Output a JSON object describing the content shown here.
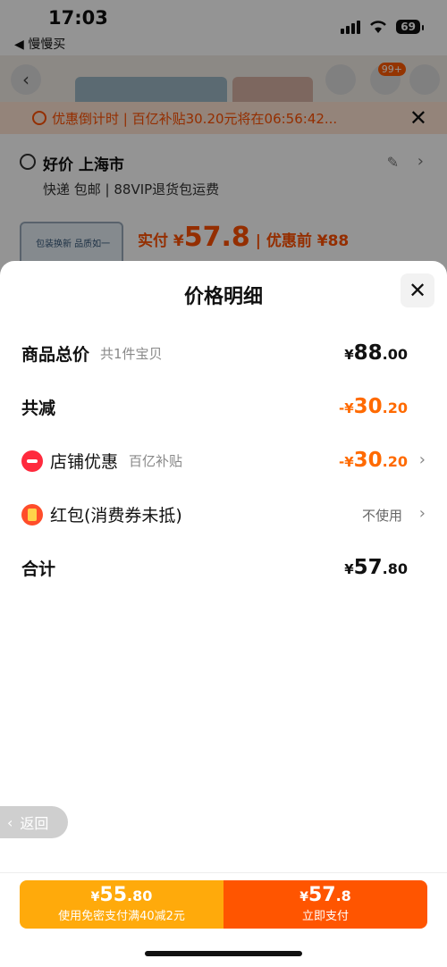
{
  "status": {
    "time": "17:03",
    "back_app": "◀ 慢慢买",
    "battery": "69"
  },
  "background": {
    "cart_badge": "99+",
    "countdown": "优惠倒计时 | 百亿补贴30.20元将在06:56:42...",
    "address_title": "好价 上海市",
    "address_sub": "快递 包邮 | 88VIP退货包运费",
    "thumb_text": "包装换新 品质如一",
    "price_line_label": "实付 ¥",
    "price_line_value": "57.8",
    "price_line_original": "| 优惠前 ¥88"
  },
  "sheet": {
    "title": "价格明细",
    "rows": [
      {
        "label": "商品总价",
        "note": "共1件宝贝",
        "cur": "¥",
        "int": "88",
        "dec": ".00"
      },
      {
        "label": "共减",
        "cur": "-¥",
        "int": "30",
        "dec": ".20"
      },
      {
        "label": "店铺优惠",
        "note": "百亿补贴",
        "cur": "-¥",
        "int": "30",
        "dec": ".20"
      },
      {
        "label": "红包(消费券未抵)",
        "value_text": "不使用"
      },
      {
        "label": "合计",
        "cur": "¥",
        "int": "57",
        "dec": ".80"
      }
    ]
  },
  "back_button": "返回",
  "pay": {
    "left": {
      "cur": "¥",
      "int": "55",
      "dec": ".80",
      "sub": "使用免密支付满40减2元"
    },
    "right": {
      "cur": "¥",
      "int": "57",
      "dec": ".8",
      "sub": "立即支付"
    }
  },
  "colors": {
    "accent_orange": "#ff6a00",
    "pay_yellow": "#ffaa0b",
    "pay_orange": "#ff5500"
  }
}
